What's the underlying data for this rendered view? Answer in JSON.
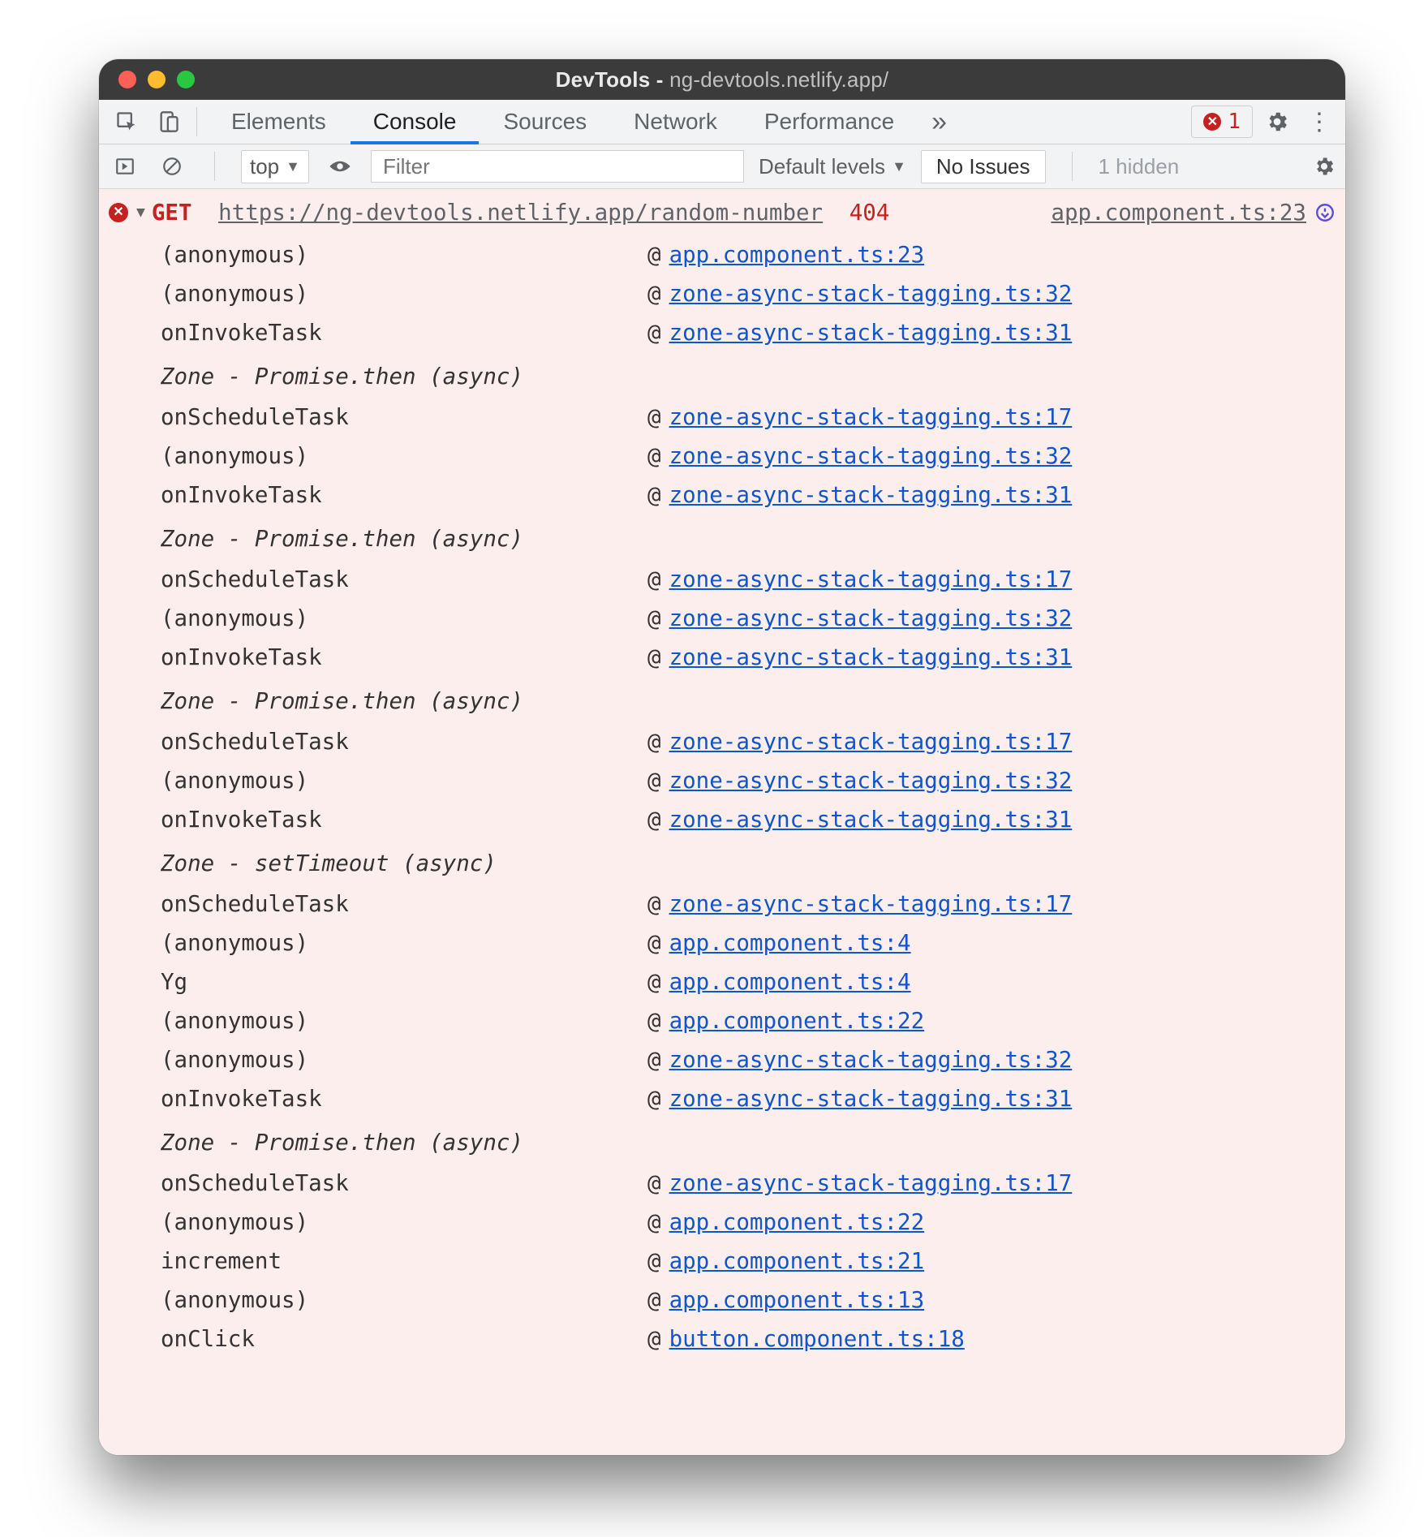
{
  "window": {
    "title_prefix": "DevTools - ",
    "title_host": "ng-devtools.netlify.app/"
  },
  "tabs": {
    "items": [
      "Elements",
      "Console",
      "Sources",
      "Network",
      "Performance"
    ],
    "active_index": 1,
    "overflow_glyph": "»",
    "error_count": "1"
  },
  "console_toolbar": {
    "context": "top",
    "filter_placeholder": "Filter",
    "levels_label": "Default levels",
    "issues_button": "No Issues",
    "hidden_label": "1 hidden"
  },
  "error": {
    "method": "GET",
    "url": "https://ng-devtools.netlify.app/random-number",
    "status": "404",
    "origin_link": "app.component.ts:23"
  },
  "stack": [
    {
      "type": "frame",
      "fn": "(anonymous)",
      "src": "app.component.ts:23"
    },
    {
      "type": "frame",
      "fn": "(anonymous)",
      "src": "zone-async-stack-tagging.ts:32"
    },
    {
      "type": "frame",
      "fn": "onInvokeTask",
      "src": "zone-async-stack-tagging.ts:31"
    },
    {
      "type": "header",
      "label": "Zone - Promise.then (async)"
    },
    {
      "type": "frame",
      "fn": "onScheduleTask",
      "src": "zone-async-stack-tagging.ts:17"
    },
    {
      "type": "frame",
      "fn": "(anonymous)",
      "src": "zone-async-stack-tagging.ts:32"
    },
    {
      "type": "frame",
      "fn": "onInvokeTask",
      "src": "zone-async-stack-tagging.ts:31"
    },
    {
      "type": "header",
      "label": "Zone - Promise.then (async)"
    },
    {
      "type": "frame",
      "fn": "onScheduleTask",
      "src": "zone-async-stack-tagging.ts:17"
    },
    {
      "type": "frame",
      "fn": "(anonymous)",
      "src": "zone-async-stack-tagging.ts:32"
    },
    {
      "type": "frame",
      "fn": "onInvokeTask",
      "src": "zone-async-stack-tagging.ts:31"
    },
    {
      "type": "header",
      "label": "Zone - Promise.then (async)"
    },
    {
      "type": "frame",
      "fn": "onScheduleTask",
      "src": "zone-async-stack-tagging.ts:17"
    },
    {
      "type": "frame",
      "fn": "(anonymous)",
      "src": "zone-async-stack-tagging.ts:32"
    },
    {
      "type": "frame",
      "fn": "onInvokeTask",
      "src": "zone-async-stack-tagging.ts:31"
    },
    {
      "type": "header",
      "label": "Zone - setTimeout (async)"
    },
    {
      "type": "frame",
      "fn": "onScheduleTask",
      "src": "zone-async-stack-tagging.ts:17"
    },
    {
      "type": "frame",
      "fn": "(anonymous)",
      "src": "app.component.ts:4"
    },
    {
      "type": "frame",
      "fn": "Yg",
      "src": "app.component.ts:4"
    },
    {
      "type": "frame",
      "fn": "(anonymous)",
      "src": "app.component.ts:22"
    },
    {
      "type": "frame",
      "fn": "(anonymous)",
      "src": "zone-async-stack-tagging.ts:32"
    },
    {
      "type": "frame",
      "fn": "onInvokeTask",
      "src": "zone-async-stack-tagging.ts:31"
    },
    {
      "type": "header",
      "label": "Zone - Promise.then (async)"
    },
    {
      "type": "frame",
      "fn": "onScheduleTask",
      "src": "zone-async-stack-tagging.ts:17"
    },
    {
      "type": "frame",
      "fn": "(anonymous)",
      "src": "app.component.ts:22"
    },
    {
      "type": "frame",
      "fn": "increment",
      "src": "app.component.ts:21"
    },
    {
      "type": "frame",
      "fn": "(anonymous)",
      "src": "app.component.ts:13"
    },
    {
      "type": "frame",
      "fn": "onClick",
      "src": "button.component.ts:18"
    }
  ]
}
